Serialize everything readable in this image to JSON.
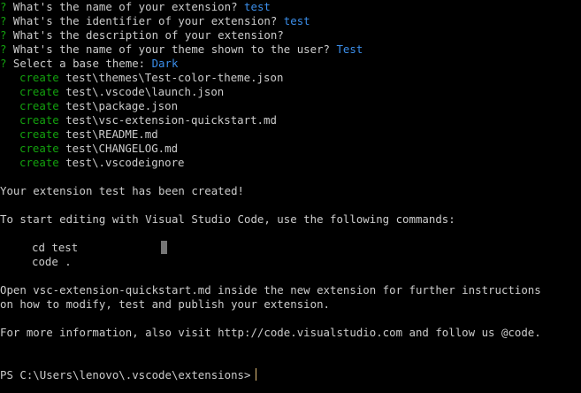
{
  "questions": [
    {
      "marker": "?",
      "text": " What's the name of your extension? ",
      "answer": "test"
    },
    {
      "marker": "?",
      "text": " What's the identifier of your extension? ",
      "answer": "test"
    },
    {
      "marker": "?",
      "text": " What's the description of your extension?",
      "answer": ""
    },
    {
      "marker": "?",
      "text": " What's the name of your theme shown to the user? ",
      "answer": "Test"
    },
    {
      "marker": "?",
      "text": " Select a base theme: ",
      "answer": "Dark"
    }
  ],
  "created_files": [
    {
      "verb": "create",
      "path": " test\\themes\\Test-color-theme.json"
    },
    {
      "verb": "create",
      "path": " test\\.vscode\\launch.json"
    },
    {
      "verb": "create",
      "path": " test\\package.json"
    },
    {
      "verb": "create",
      "path": " test\\vsc-extension-quickstart.md"
    },
    {
      "verb": "create",
      "path": " test\\README.md"
    },
    {
      "verb": "create",
      "path": " test\\CHANGELOG.md"
    },
    {
      "verb": "create",
      "path": " test\\.vscodeignore"
    }
  ],
  "messages": {
    "created": "Your extension test has been created!",
    "start_editing": "To start editing with Visual Studio Code, use the following commands:",
    "commands": [
      "cd test",
      "code ."
    ],
    "open_line1": "Open vsc-extension-quickstart.md inside the new extension for further instructions",
    "open_line2": "on how to modify, test and publish your extension.",
    "more_info": "For more information, also visit http://code.visualstudio.com and follow us @code."
  },
  "prompt": "PS C:\\Users\\lenovo\\.vscode\\extensions>",
  "colors": {
    "background": "#000000",
    "text": "#cccccc",
    "question_marker": "#13a10e",
    "answer": "#3b8eea",
    "create_verb": "#13a10e",
    "cursor": "#e5c07b"
  }
}
